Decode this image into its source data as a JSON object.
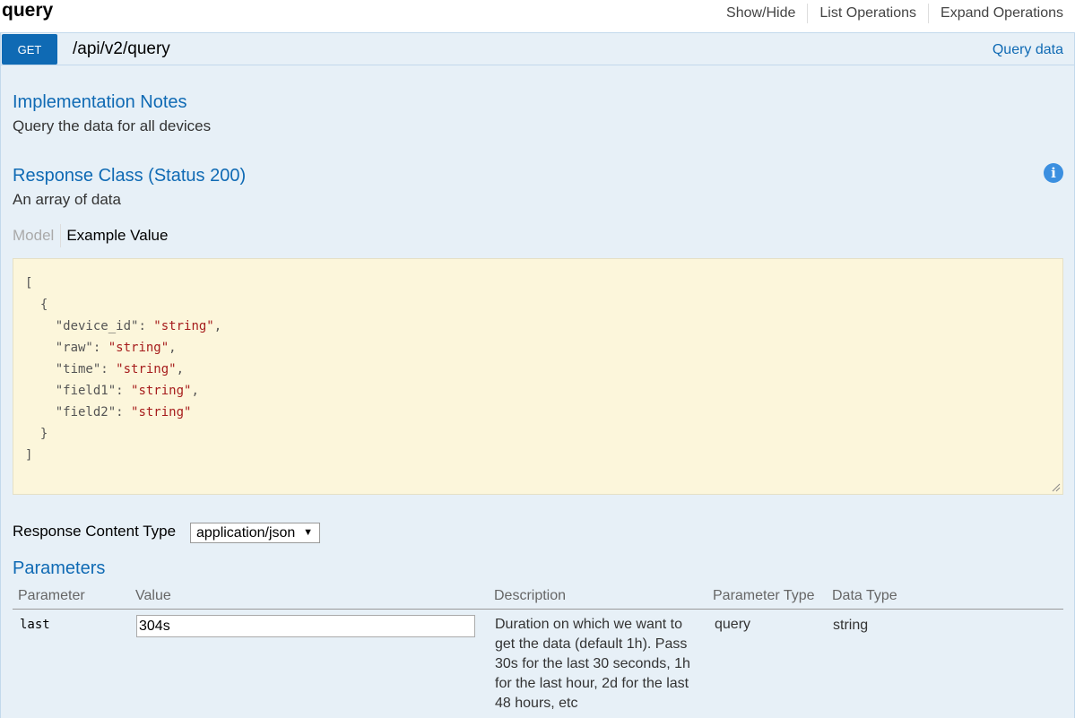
{
  "resource": {
    "title": "query",
    "links": [
      "Show/Hide",
      "List Operations",
      "Expand Operations"
    ]
  },
  "operation": {
    "method": "GET",
    "path": "/api/v2/query",
    "summary": "Query data",
    "method_color": "#0f6ab4"
  },
  "implementation": {
    "heading": "Implementation Notes",
    "text": "Query the data for all devices"
  },
  "response_class": {
    "heading": "Response Class (Status 200)",
    "text": "An array of data",
    "tabs": {
      "model": "Model",
      "example": "Example Value"
    },
    "example": {
      "open_bracket": "[",
      "open_brace": "{",
      "fields": [
        {
          "key": "\"device_id\"",
          "value": "\"string\"",
          "comma": ","
        },
        {
          "key": "\"raw\"",
          "value": "\"string\"",
          "comma": ","
        },
        {
          "key": "\"time\"",
          "value": "\"string\"",
          "comma": ","
        },
        {
          "key": "\"field1\"",
          "value": "\"string\"",
          "comma": ","
        },
        {
          "key": "\"field2\"",
          "value": "\"string\"",
          "comma": ""
        }
      ],
      "close_brace": "}",
      "close_bracket": "]"
    }
  },
  "response_content_type": {
    "label": "Response Content Type",
    "selected": "application/json"
  },
  "parameters": {
    "heading": "Parameters",
    "columns": [
      "Parameter",
      "Value",
      "Description",
      "Parameter Type",
      "Data Type"
    ],
    "rows": [
      {
        "name": "last",
        "value": "304s",
        "description": "Duration on which we want to get the data (default 1h). Pass 30s for the last 30 seconds, 1h for the last hour, 2d for the last 48 hours, etc",
        "param_type": "query",
        "data_type": "string"
      }
    ]
  }
}
